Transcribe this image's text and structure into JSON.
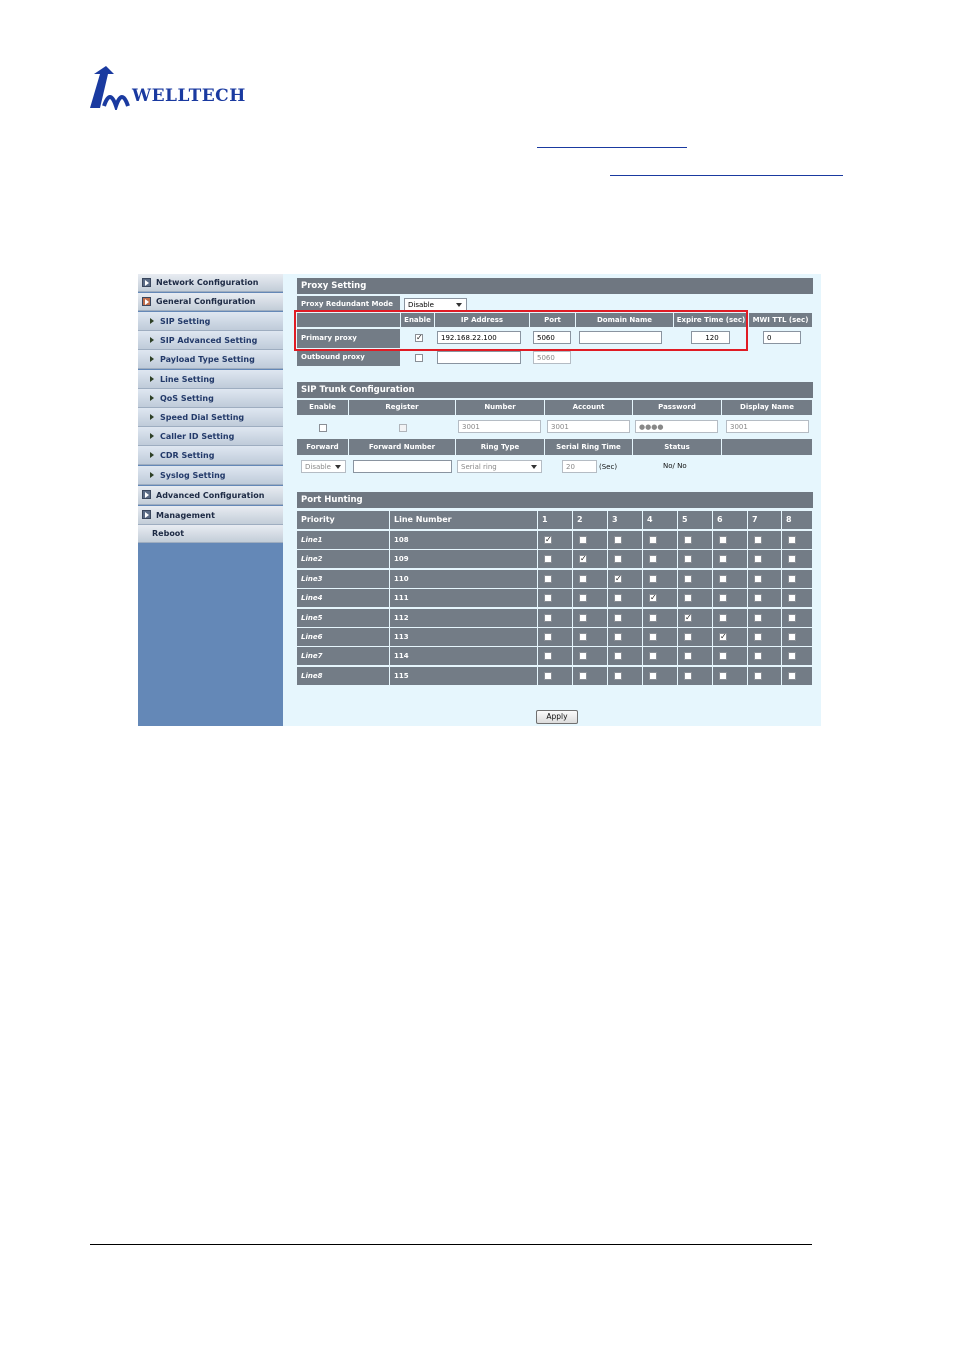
{
  "doc": {
    "logo_text": "WELLTECH"
  },
  "sidebar": {
    "network": "Network Configuration",
    "general": "General Configuration",
    "subs": [
      "SIP Setting",
      "SIP Advanced Setting",
      "Payload Type Setting",
      "Line Setting",
      "QoS Setting",
      "Speed Dial Setting",
      "Caller ID Setting",
      "CDR Setting",
      "Syslog Setting"
    ],
    "advanced": "Advanced Configuration",
    "management": "Management",
    "reboot": "Reboot"
  },
  "proxy": {
    "title": "Proxy Setting",
    "redundant_label": "Proxy Redundant Mode",
    "redundant_value": "Disable",
    "headers": [
      "Enable",
      "IP Address",
      "Port",
      "Domain Name",
      "Expire Time (sec)",
      "MWI TTL (sec)"
    ],
    "primary_label": "Primary proxy",
    "primary_ip": "192.168.22.100",
    "primary_port": "5060",
    "primary_domain": "",
    "primary_expire": "120",
    "primary_mwi": "0",
    "outbound_label": "Outbound proxy",
    "outbound_ip": "",
    "outbound_port": "5060"
  },
  "trunk": {
    "title": "SIP Trunk Configuration",
    "headers": [
      "Enable",
      "Register",
      "Number",
      "Account",
      "Password",
      "Display Name"
    ],
    "number": "3001",
    "account": "3001",
    "password": "●●●●",
    "display_name": "3001",
    "headers2": [
      "Forward",
      "Forward Number",
      "Ring Type",
      "Serial Ring Time",
      "Status"
    ],
    "forward": "Disable",
    "forward_number": "",
    "ring_type": "Serial ring",
    "serial_time": "20",
    "serial_unit": "(Sec)",
    "status": "No/ No"
  },
  "hunting": {
    "title": "Port Hunting",
    "col_priority": "Priority",
    "col_line": "Line Number",
    "cols": [
      "1",
      "2",
      "3",
      "4",
      "5",
      "6",
      "7",
      "8"
    ],
    "rows": [
      {
        "name": "Line1",
        "number": "108",
        "checked": 1
      },
      {
        "name": "Line2",
        "number": "109",
        "checked": 2
      },
      {
        "name": "Line3",
        "number": "110",
        "checked": 3
      },
      {
        "name": "Line4",
        "number": "111",
        "checked": 4
      },
      {
        "name": "Line5",
        "number": "112",
        "checked": 5
      },
      {
        "name": "Line6",
        "number": "113",
        "checked": 6
      },
      {
        "name": "Line7",
        "number": "114",
        "checked": 0
      },
      {
        "name": "Line8",
        "number": "115",
        "checked": 0
      }
    ]
  },
  "apply_label": "Apply",
  "colors": {
    "header": "#6f7781",
    "sidebar": "#6488b7",
    "highlight": "#e01b24",
    "background": "#e6f6fd"
  }
}
